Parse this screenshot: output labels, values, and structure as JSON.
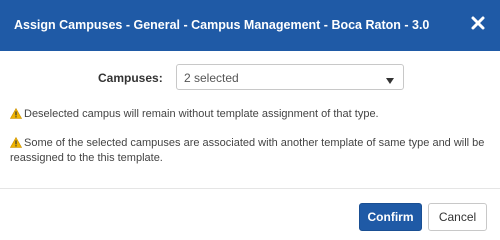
{
  "dialog": {
    "title": "Assign Campuses - General - Campus Management - Boca Raton - 3.0",
    "close_icon": "close-icon"
  },
  "form": {
    "campuses_label": "Campuses:",
    "campuses_selected": "2 selected"
  },
  "notices": [
    {
      "icon": "warning-icon",
      "text": "Deselected campus will remain without template assignment of that type."
    },
    {
      "icon": "warning-icon",
      "text": "Some of the selected campuses are associated with another template of same type and will be reassigned to the this template."
    }
  ],
  "buttons": {
    "confirm_label": "Confirm",
    "cancel_label": "Cancel"
  },
  "colors": {
    "header_bg": "#1f5aa6",
    "primary_button": "#1f5aa6",
    "warning_icon": "#f0b400"
  }
}
